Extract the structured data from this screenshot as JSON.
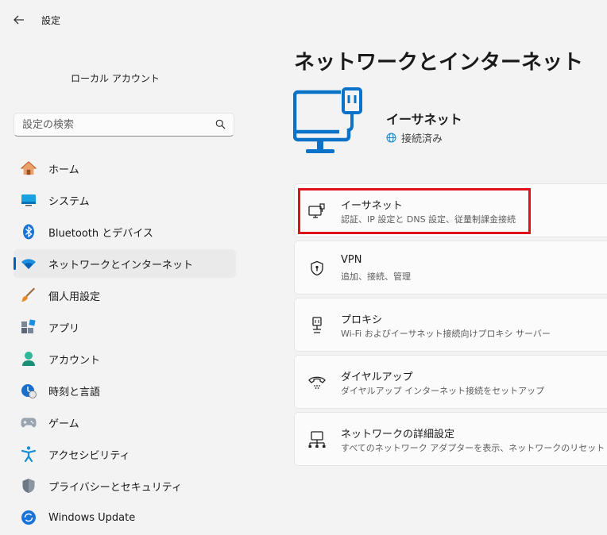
{
  "window": {
    "title": "設定"
  },
  "account": {
    "name": "ローカル アカウント"
  },
  "search": {
    "placeholder": "設定の検索"
  },
  "sidebar": {
    "items": [
      {
        "label": "ホーム",
        "icon": "home-icon"
      },
      {
        "label": "システム",
        "icon": "system-icon"
      },
      {
        "label": "Bluetooth とデバイス",
        "icon": "bluetooth-icon"
      },
      {
        "label": "ネットワークとインターネット",
        "icon": "wifi-icon",
        "active": true
      },
      {
        "label": "個人用設定",
        "icon": "brush-icon"
      },
      {
        "label": "アプリ",
        "icon": "apps-icon"
      },
      {
        "label": "アカウント",
        "icon": "account-icon"
      },
      {
        "label": "時刻と言語",
        "icon": "time-language-icon"
      },
      {
        "label": "ゲーム",
        "icon": "gamepad-icon"
      },
      {
        "label": "アクセシビリティ",
        "icon": "accessibility-icon"
      },
      {
        "label": "プライバシーとセキュリティ",
        "icon": "shield-icon"
      },
      {
        "label": "Windows Update",
        "icon": "update-icon"
      }
    ]
  },
  "main": {
    "title": "ネットワークとインターネット",
    "hero": {
      "name": "イーサネット",
      "status": "接続済み"
    },
    "cards": [
      {
        "title": "イーサネット",
        "subtitle": "認証、IP 設定と DNS 設定、従量制課金接続",
        "icon": "ethernet-icon",
        "highlighted": true
      },
      {
        "title": "VPN",
        "subtitle": "追加、接続、管理",
        "icon": "vpn-shield-icon"
      },
      {
        "title": "プロキシ",
        "subtitle": "Wi-Fi およびイーサネット接続向けプロキシ サーバー",
        "icon": "proxy-icon"
      },
      {
        "title": "ダイヤルアップ",
        "subtitle": "ダイヤルアップ インターネット接続をセットアップ",
        "icon": "dialup-icon"
      },
      {
        "title": "ネットワークの詳細設定",
        "subtitle": "すべてのネットワーク アダプターを表示、ネットワークのリセット",
        "icon": "network-advanced-icon"
      }
    ]
  },
  "colors": {
    "accent": "#005fb8",
    "highlight": "#e0101d",
    "icon_blue": "#0a72c9"
  }
}
